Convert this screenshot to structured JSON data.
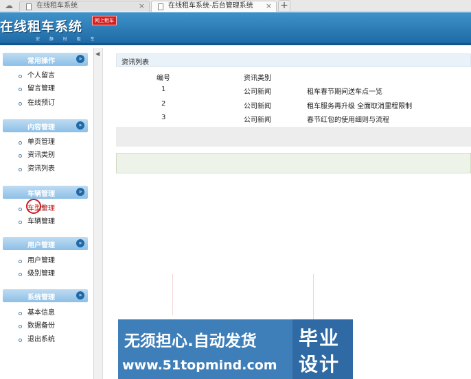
{
  "browser": {
    "tabs": [
      {
        "title": "在线租车系统",
        "active": false
      },
      {
        "title": "在线租车系统-后台管理系统",
        "active": true
      }
    ],
    "new_tab_label": "+",
    "close_glyph": "×"
  },
  "header": {
    "logo": "在线租车系统",
    "logo_sub": "安 静 时 租 车",
    "badge": "网上租车"
  },
  "sidebar": {
    "collapse_glyph": "»",
    "groups": [
      {
        "title": "常用操作",
        "items": [
          "个人留言",
          "留言管理",
          "在线预订"
        ]
      },
      {
        "title": "内容管理",
        "items": [
          "单页管理",
          "资讯类别",
          "资讯列表"
        ]
      },
      {
        "title": "车辆管理",
        "items": [
          "车型管理",
          "车辆管理"
        ]
      },
      {
        "title": "用户管理",
        "items": [
          "用户管理",
          "级别管理"
        ]
      },
      {
        "title": "系统管理",
        "items": [
          "基本信息",
          "数据备份",
          "退出系统"
        ]
      }
    ],
    "current_item": "车型管理"
  },
  "content": {
    "panel_title": "资讯列表",
    "columns": [
      "编号",
      "资讯类别",
      ""
    ],
    "rows": [
      {
        "id": "1",
        "category": "公司新闻",
        "title": "租车春节期间送车点一览"
      },
      {
        "id": "2",
        "category": "公司新闻",
        "title": "租车服务再升级 全面取消里程限制"
      },
      {
        "id": "3",
        "category": "公司新闻",
        "title": "春节红包的使用细则与流程"
      }
    ]
  },
  "watermark": {
    "line1": "无须担心.自动发货",
    "line2": "www.51topmind.com",
    "box_line1": "毕业",
    "box_line2": "设计"
  },
  "colors": {
    "header_blue": "#1f6aa6",
    "group_head": "#8cbfe6",
    "current_item": "#c21b1b",
    "ad_blue": "#3f7fb9"
  }
}
